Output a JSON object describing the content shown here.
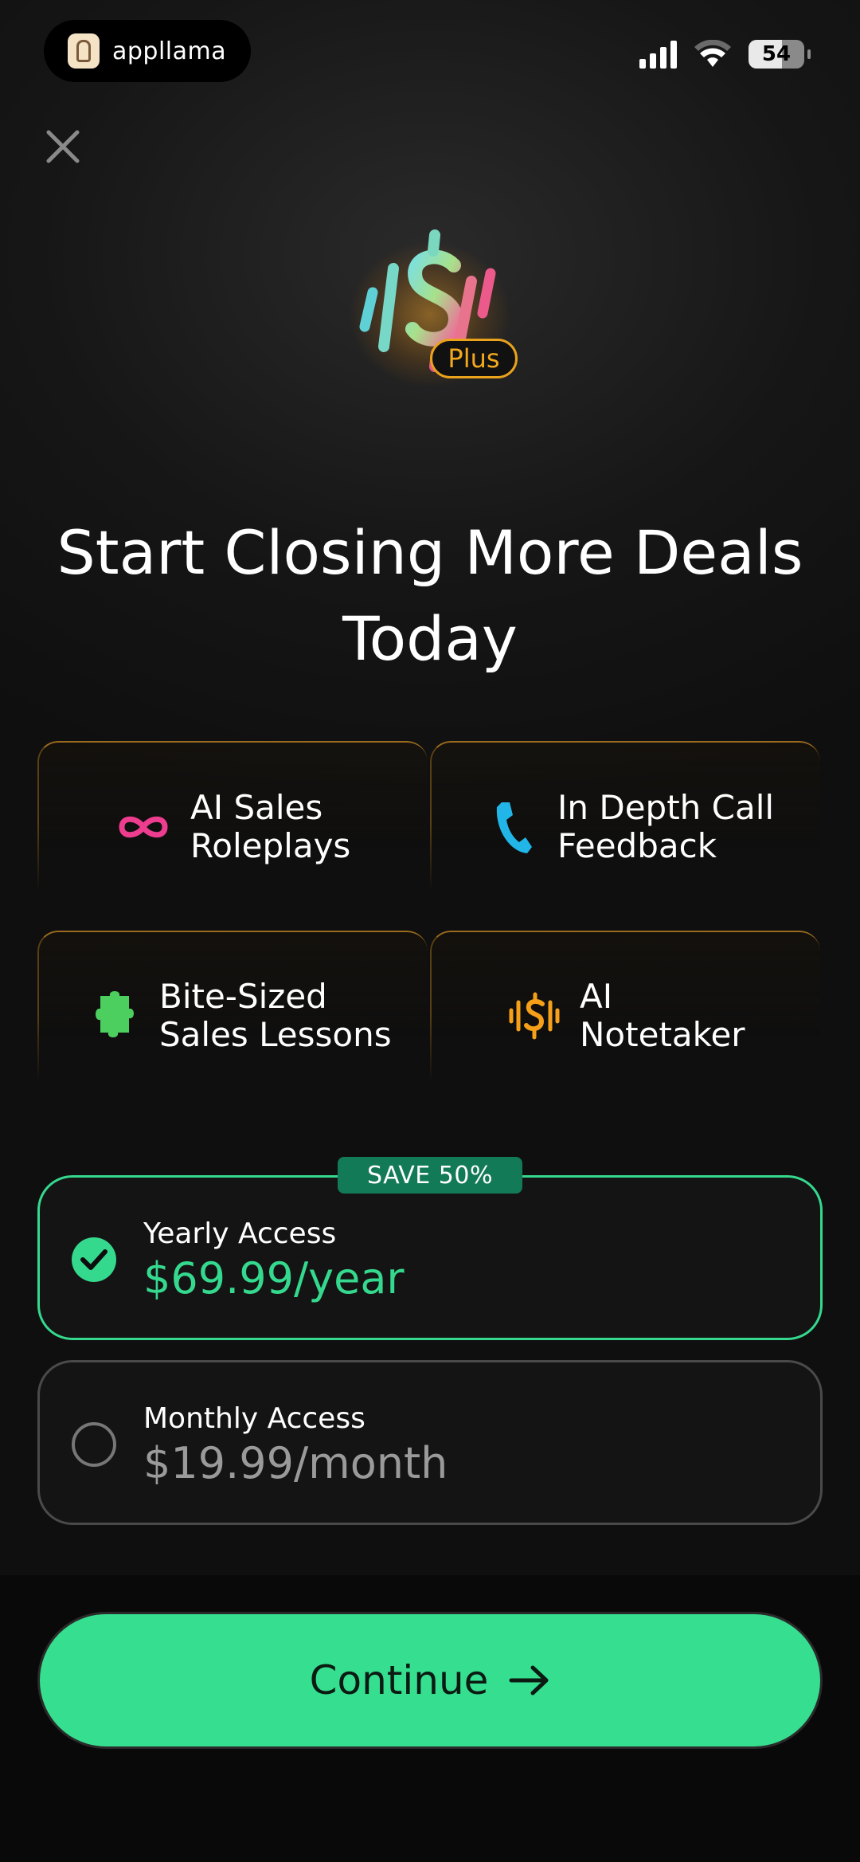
{
  "status_bar": {
    "brand_name": "appllama",
    "battery_level": "54",
    "signal_bars": 4
  },
  "close_icon": "close-icon",
  "hero": {
    "badge_label": "Plus",
    "headline": "Start Closing More Deals Today"
  },
  "features": [
    {
      "label": "AI Sales\nRoleplays",
      "icon": "infinity-icon",
      "color": "#ee3d8f"
    },
    {
      "label": "In Depth Call\nFeedback",
      "icon": "phone-icon",
      "color": "#22b6e8"
    },
    {
      "label": "Bite-Sized\nSales Lessons",
      "icon": "puzzle-icon",
      "color": "#4ccf5f"
    },
    {
      "label": "AI\nNotetaker",
      "icon": "dollar-wave-icon",
      "color": "#f5a018"
    }
  ],
  "plans": {
    "save_badge": "SAVE 50%",
    "yearly": {
      "name": "Yearly Access",
      "price": "$69.99/year",
      "selected": true
    },
    "monthly": {
      "name": "Monthly Access",
      "price": "$19.99/month",
      "selected": false
    }
  },
  "cta": {
    "label": "Continue"
  },
  "colors": {
    "accent": "#35df8f",
    "accent_dark": "#137a58",
    "badge_gold": "#f2a81d"
  }
}
